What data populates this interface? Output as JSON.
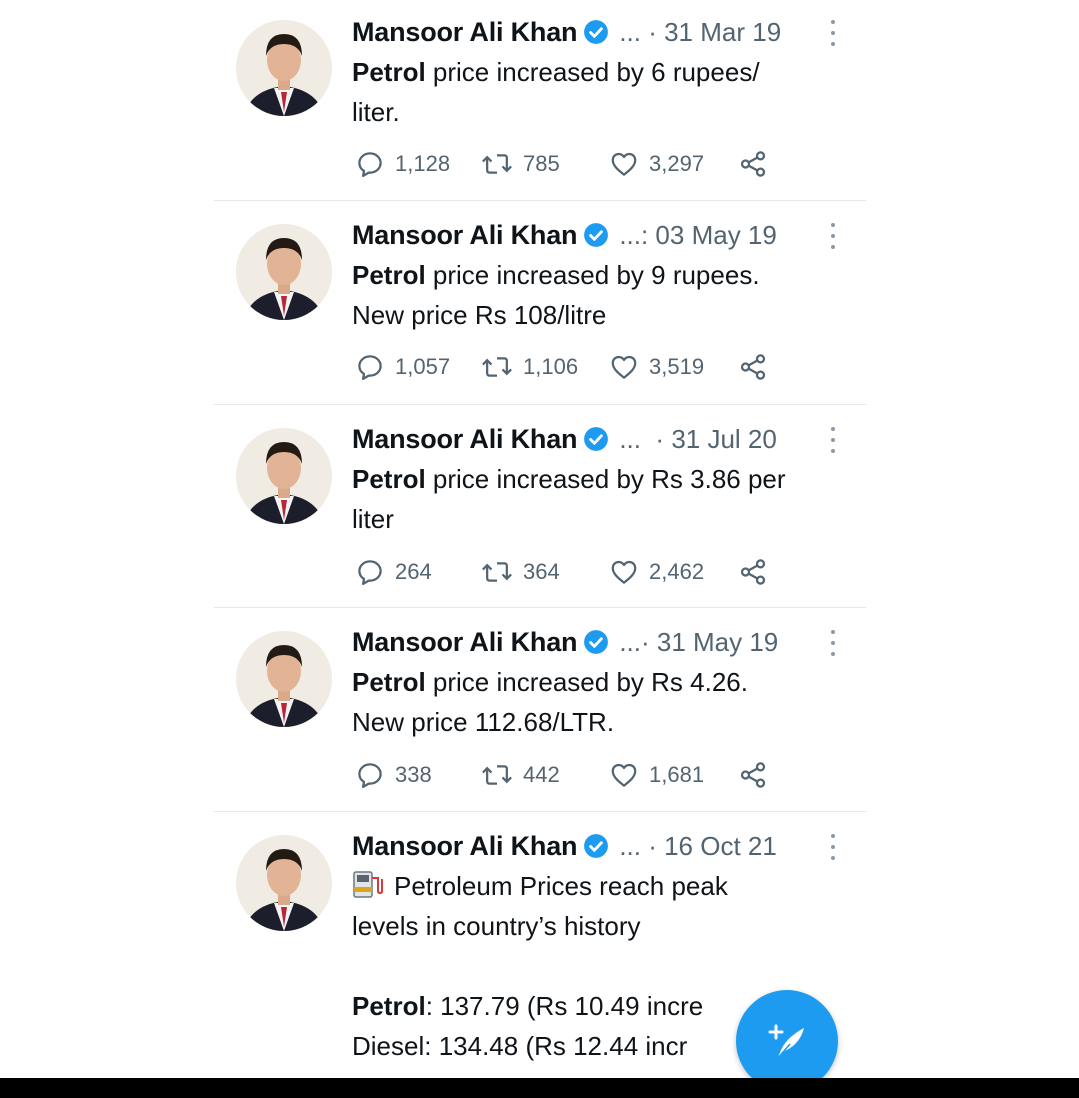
{
  "tweets": [
    {
      "author": "Mansoor Ali Khan",
      "meta": "... · 31 Mar 19",
      "text_bold": "Petrol",
      "text_rest": " price increased by 6 rupees/",
      "text_line2": "liter.",
      "replies": "1,128",
      "retweets": "785",
      "likes": "3,297"
    },
    {
      "author": "Mansoor Ali Khan",
      "meta": "...: 03 May 19",
      "text_bold": "Petrol",
      "text_rest": " price increased by 9 rupees.",
      "text_line2": "New price Rs 108/litre",
      "replies": "1,057",
      "retweets": "1,106",
      "likes": "3,519"
    },
    {
      "author": "Mansoor Ali Khan",
      "meta": "...  · 31 Jul 20",
      "text_bold": "Petrol",
      "text_rest": " price increased by Rs 3.86 per",
      "text_line2": "liter",
      "replies": "264",
      "retweets": "364",
      "likes": "2,462"
    },
    {
      "author": "Mansoor Ali Khan",
      "meta": "...· 31 May 19",
      "text_bold": "Petrol",
      "text_rest": " price increased by Rs 4.26.",
      "text_line2": "New price 112.68/LTR.",
      "replies": "338",
      "retweets": "442",
      "likes": "1,681"
    },
    {
      "author": "Mansoor Ali Khan",
      "meta": "... · 16 Oct 21",
      "line1": "Petroleum Prices reach peak",
      "line2": "levels in country’s history",
      "petrol_label": "Petrol",
      "petrol_value": ": 137.79 (Rs 10.49 incre",
      "diesel_line": "Diesel: 134.48 (Rs 12.44 incr"
    }
  ],
  "colors": {
    "accent": "#1d9bf0",
    "text": "#0f1419",
    "muted": "#536471",
    "divider": "#e6e9ec"
  },
  "icons": {
    "reply": "reply-icon",
    "retweet": "retweet-icon",
    "like": "heart-icon",
    "share": "share-icon",
    "verified": "verified-badge-icon",
    "compose": "compose-tweet-icon",
    "fuel": "fuel-pump-icon"
  }
}
